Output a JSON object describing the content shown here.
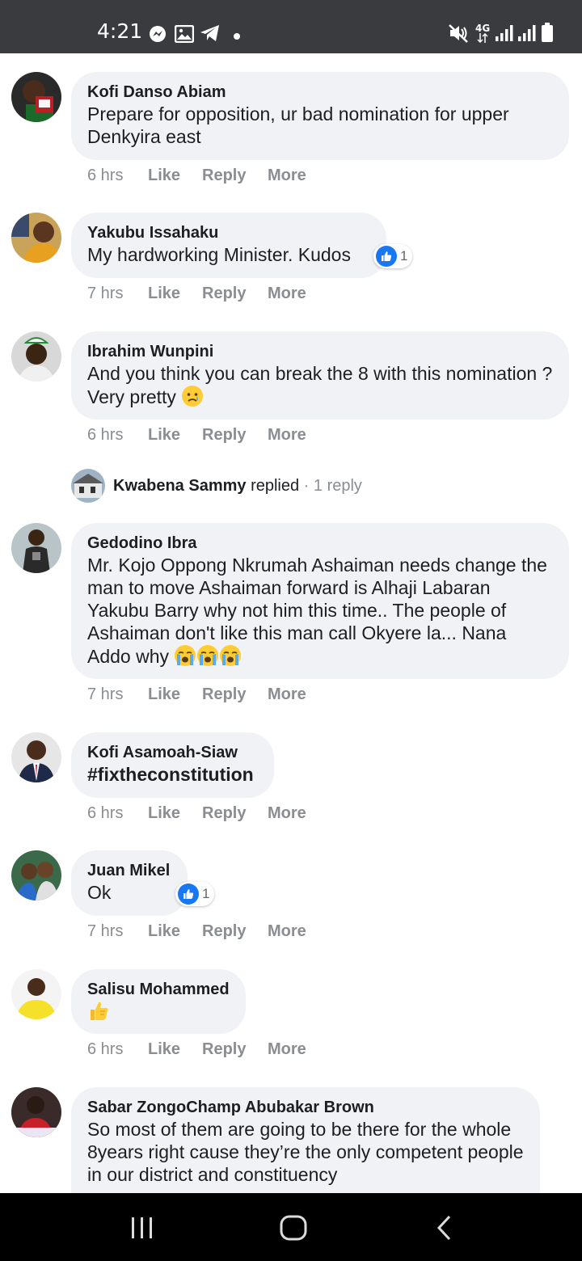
{
  "status_bar": {
    "time": "4:21",
    "network": "4G"
  },
  "comments": [
    {
      "author": "Kofi Danso Abiam",
      "text": "Prepare for opposition, ur bad nomination for upper Denkyira east",
      "time": "6 hrs"
    },
    {
      "author": "Yakubu Issahaku",
      "text": "My hardworking Minister. Kudos",
      "time": "7 hrs",
      "reaction_count": "1"
    },
    {
      "author": "Ibrahim Wunpini",
      "text": "And you think you can break the 8 with this nomination ? Very pretty",
      "time": "6 hrs",
      "replies": {
        "name": "Kwabena Sammy",
        "verb": "replied",
        "separator": " · ",
        "count": "1 reply"
      }
    },
    {
      "author": "Gedodino Ibra",
      "text": "Mr. Kojo Oppong Nkrumah Ashaiman needs change the man to move Ashaiman forward is Alhaji Labaran Yakubu Barry why not him this time.. The people of Ashaiman don't like this man call Okyere la... Nana Addo why",
      "time": "7 hrs"
    },
    {
      "author": "Kofi Asamoah-Siaw",
      "text": "#fixtheconstitution",
      "time": "6 hrs"
    },
    {
      "author": "Juan Mikel",
      "text": "Ok",
      "time": "7 hrs",
      "reaction_count": "1"
    },
    {
      "author": "Salisu Mohammed",
      "text": "",
      "time": "6 hrs"
    },
    {
      "author": "Sabar ZongoChamp Abubakar Brown",
      "text": "So most of them are going to be there for the whole 8years right cause they’re the only competent people in our district and constituency"
    }
  ],
  "action_labels": {
    "like": "Like",
    "reply": "Reply",
    "more": "More"
  },
  "colors": {
    "status_bar": "#3a3b3e",
    "bubble": "#f0f2f5",
    "meta_text": "#8a8d91",
    "like_blue": "#1877f2",
    "nav_bar": "#000000"
  }
}
